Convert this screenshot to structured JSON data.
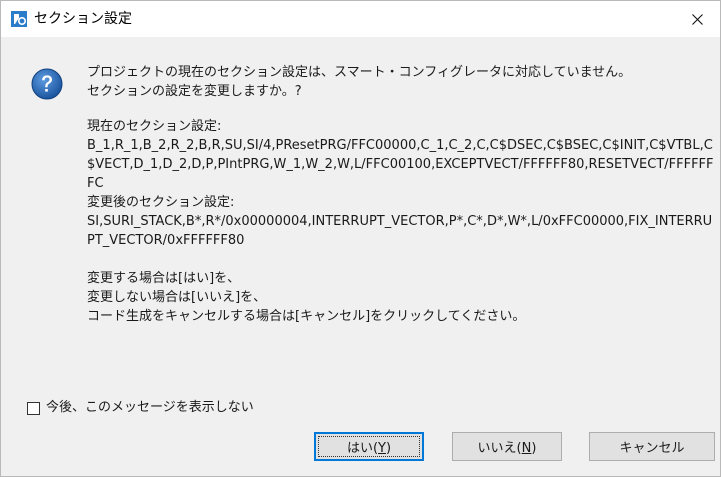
{
  "window": {
    "title": "セクション設定",
    "close_glyph": "✕"
  },
  "message": {
    "line1": "プロジェクトの現在のセクション設定は、スマート・コンフィグレータに対応していません。",
    "line2": "セクションの設定を変更しますか。?",
    "current_label": "現在のセクション設定:",
    "current_value": "B_1,R_1,B_2,R_2,B,R,SU,SI/4,PResetPRG/FFC00000,C_1,C_2,C,C$DSEC,C$BSEC,C$INIT,C$VTBL,C$VECT,D_1,D_2,D,P,PIntPRG,W_1,W_2,W,L/FFC00100,EXCEPTVECT/FFFFFF80,RESETVECT/FFFFFFFC",
    "new_label": "変更後のセクション設定:",
    "new_value": "SI,SURI_STACK,B*,R*/0x00000004,INTERRUPT_VECTOR,P*,C*,D*,W*,L/0xFFC00000,FIX_INTERRUPT_VECTOR/0xFFFFFF80",
    "instr1": "変更する場合は[はい]を、",
    "instr2": "変更しない場合は[いいえ]を、",
    "instr3": "コード生成をキャンセルする場合は[キャンセル]をクリックしてください。"
  },
  "checkbox": {
    "label": "今後、このメッセージを表示しない",
    "checked": false
  },
  "buttons": {
    "yes": {
      "label": "はい(",
      "mnemonic": "Y",
      "suffix": ")"
    },
    "no": {
      "label": "いいえ(",
      "mnemonic": "N",
      "suffix": ")"
    },
    "cancel": {
      "label": "キャンセル"
    }
  },
  "icons": {
    "app": "renesas-app-icon",
    "message": "question-icon",
    "close": "close-icon"
  },
  "colors": {
    "dialog_bg": "#f0f0f0",
    "titlebar_bg": "#ffffff",
    "question_icon": "#1f5fa8",
    "default_button_border": "#0078d7",
    "button_bg": "#e1e1e1"
  }
}
